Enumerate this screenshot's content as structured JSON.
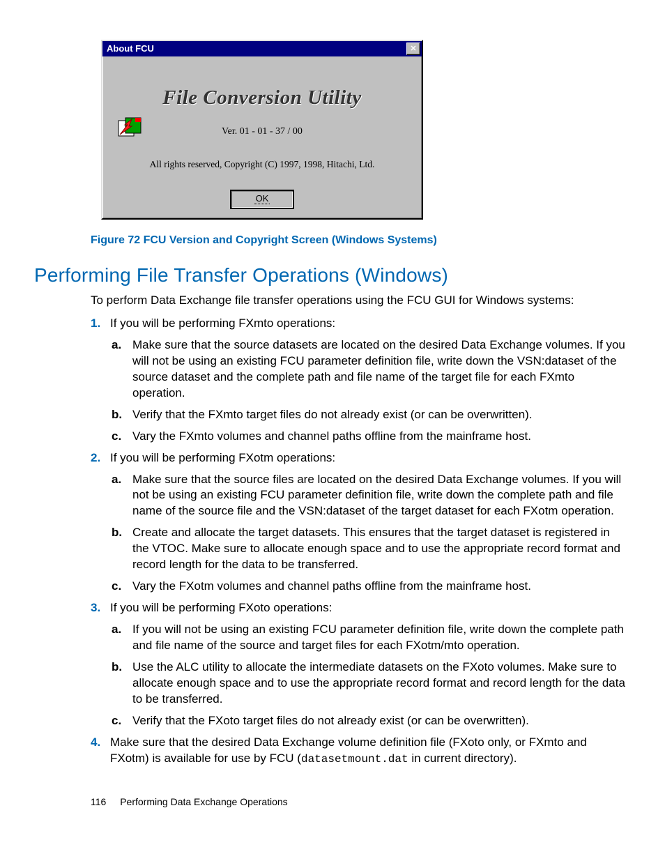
{
  "dialog": {
    "title": "About FCU",
    "close_glyph": "✕",
    "app_title": "File Conversion Utility",
    "version_line": "Ver.  01 - 01 - 37 / 00",
    "copyright_line": "All rights reserved, Copyright (C) 1997, 1998, Hitachi, Ltd.",
    "ok_label": "OK"
  },
  "figure_caption": "Figure 72 FCU Version and Copyright Screen (Windows Systems)",
  "heading": "Performing File Transfer Operations (Windows)",
  "intro": "To perform Data Exchange file transfer operations using the FCU GUI for Windows systems:",
  "list": [
    {
      "text": "If you will be performing FXmto operations:",
      "sub": [
        "Make sure that the source datasets are located on the desired Data Exchange volumes. If you will not be using an existing FCU parameter definition file, write down the VSN:dataset of the source dataset and the complete path and file name of the target file for each FXmto operation.",
        "Verify that the FXmto target files do not already exist (or can be overwritten).",
        "Vary the FXmto volumes and channel paths offline from the mainframe host."
      ]
    },
    {
      "text": "If you will be performing FXotm operations:",
      "sub": [
        "Make sure that the source files are located on the desired Data Exchange volumes. If you will not be using an existing FCU parameter definition file, write down the complete path and file name of the source file and the VSN:dataset of the target dataset for each FXotm operation.",
        "Create and allocate the target datasets. This ensures that the target dataset is registered in the VTOC. Make sure to allocate enough space and to use the appropriate record format and record length for the data to be transferred.",
        "Vary the FXotm volumes and channel paths offline from the mainframe host."
      ]
    },
    {
      "text": "If you will be performing FXoto operations:",
      "sub": [
        "If you will not be using an existing FCU parameter definition file, write down the complete path and file name of the source and target files for each FXotm/mto operation.",
        "Use the ALC utility to allocate the intermediate datasets on the FXoto volumes. Make sure to allocate enough space and to use the appropriate record format and record length for the data to be transferred.",
        "Verify that the FXoto target files do not already exist (or can be overwritten)."
      ]
    },
    {
      "text_pre": "Make sure that the desired Data Exchange volume definition file (FXoto only, or FXmto and FXotm) is available for use by FCU (",
      "code": "datasetmount.dat",
      "text_post": " in current directory).",
      "sub": []
    }
  ],
  "footer": {
    "page_number": "116",
    "section": "Performing Data Exchange Operations"
  }
}
